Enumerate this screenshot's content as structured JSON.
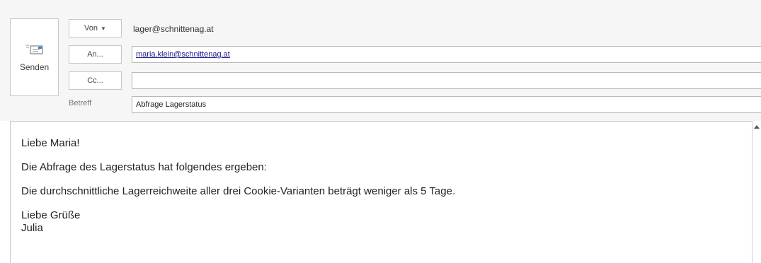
{
  "send": {
    "label": "Senden",
    "icon": "send-mail-icon"
  },
  "fields": {
    "from": {
      "button_label": "Von",
      "dropdown_icon": "chevron-down-icon",
      "value": "lager@schnittenag.at"
    },
    "to": {
      "button_label": "An...",
      "value": "maria.klein@schnittenag.at"
    },
    "cc": {
      "button_label": "Cc...",
      "value": ""
    },
    "subject": {
      "label": "Betreff",
      "value": "Abfrage Lagerstatus"
    }
  },
  "body": {
    "greeting": "Liebe Maria!",
    "line1": "Die Abfrage des Lagerstatus hat folgendes ergeben:",
    "line2": "Die durchschnittliche Lagerreichweite aller drei Cookie-Varianten beträgt weniger als 5 Tage.",
    "closing": "Liebe Grüße",
    "signature": "Julia"
  },
  "colors": {
    "recipient_link": "#1a1a8a",
    "header_background": "#f6f6f6"
  }
}
